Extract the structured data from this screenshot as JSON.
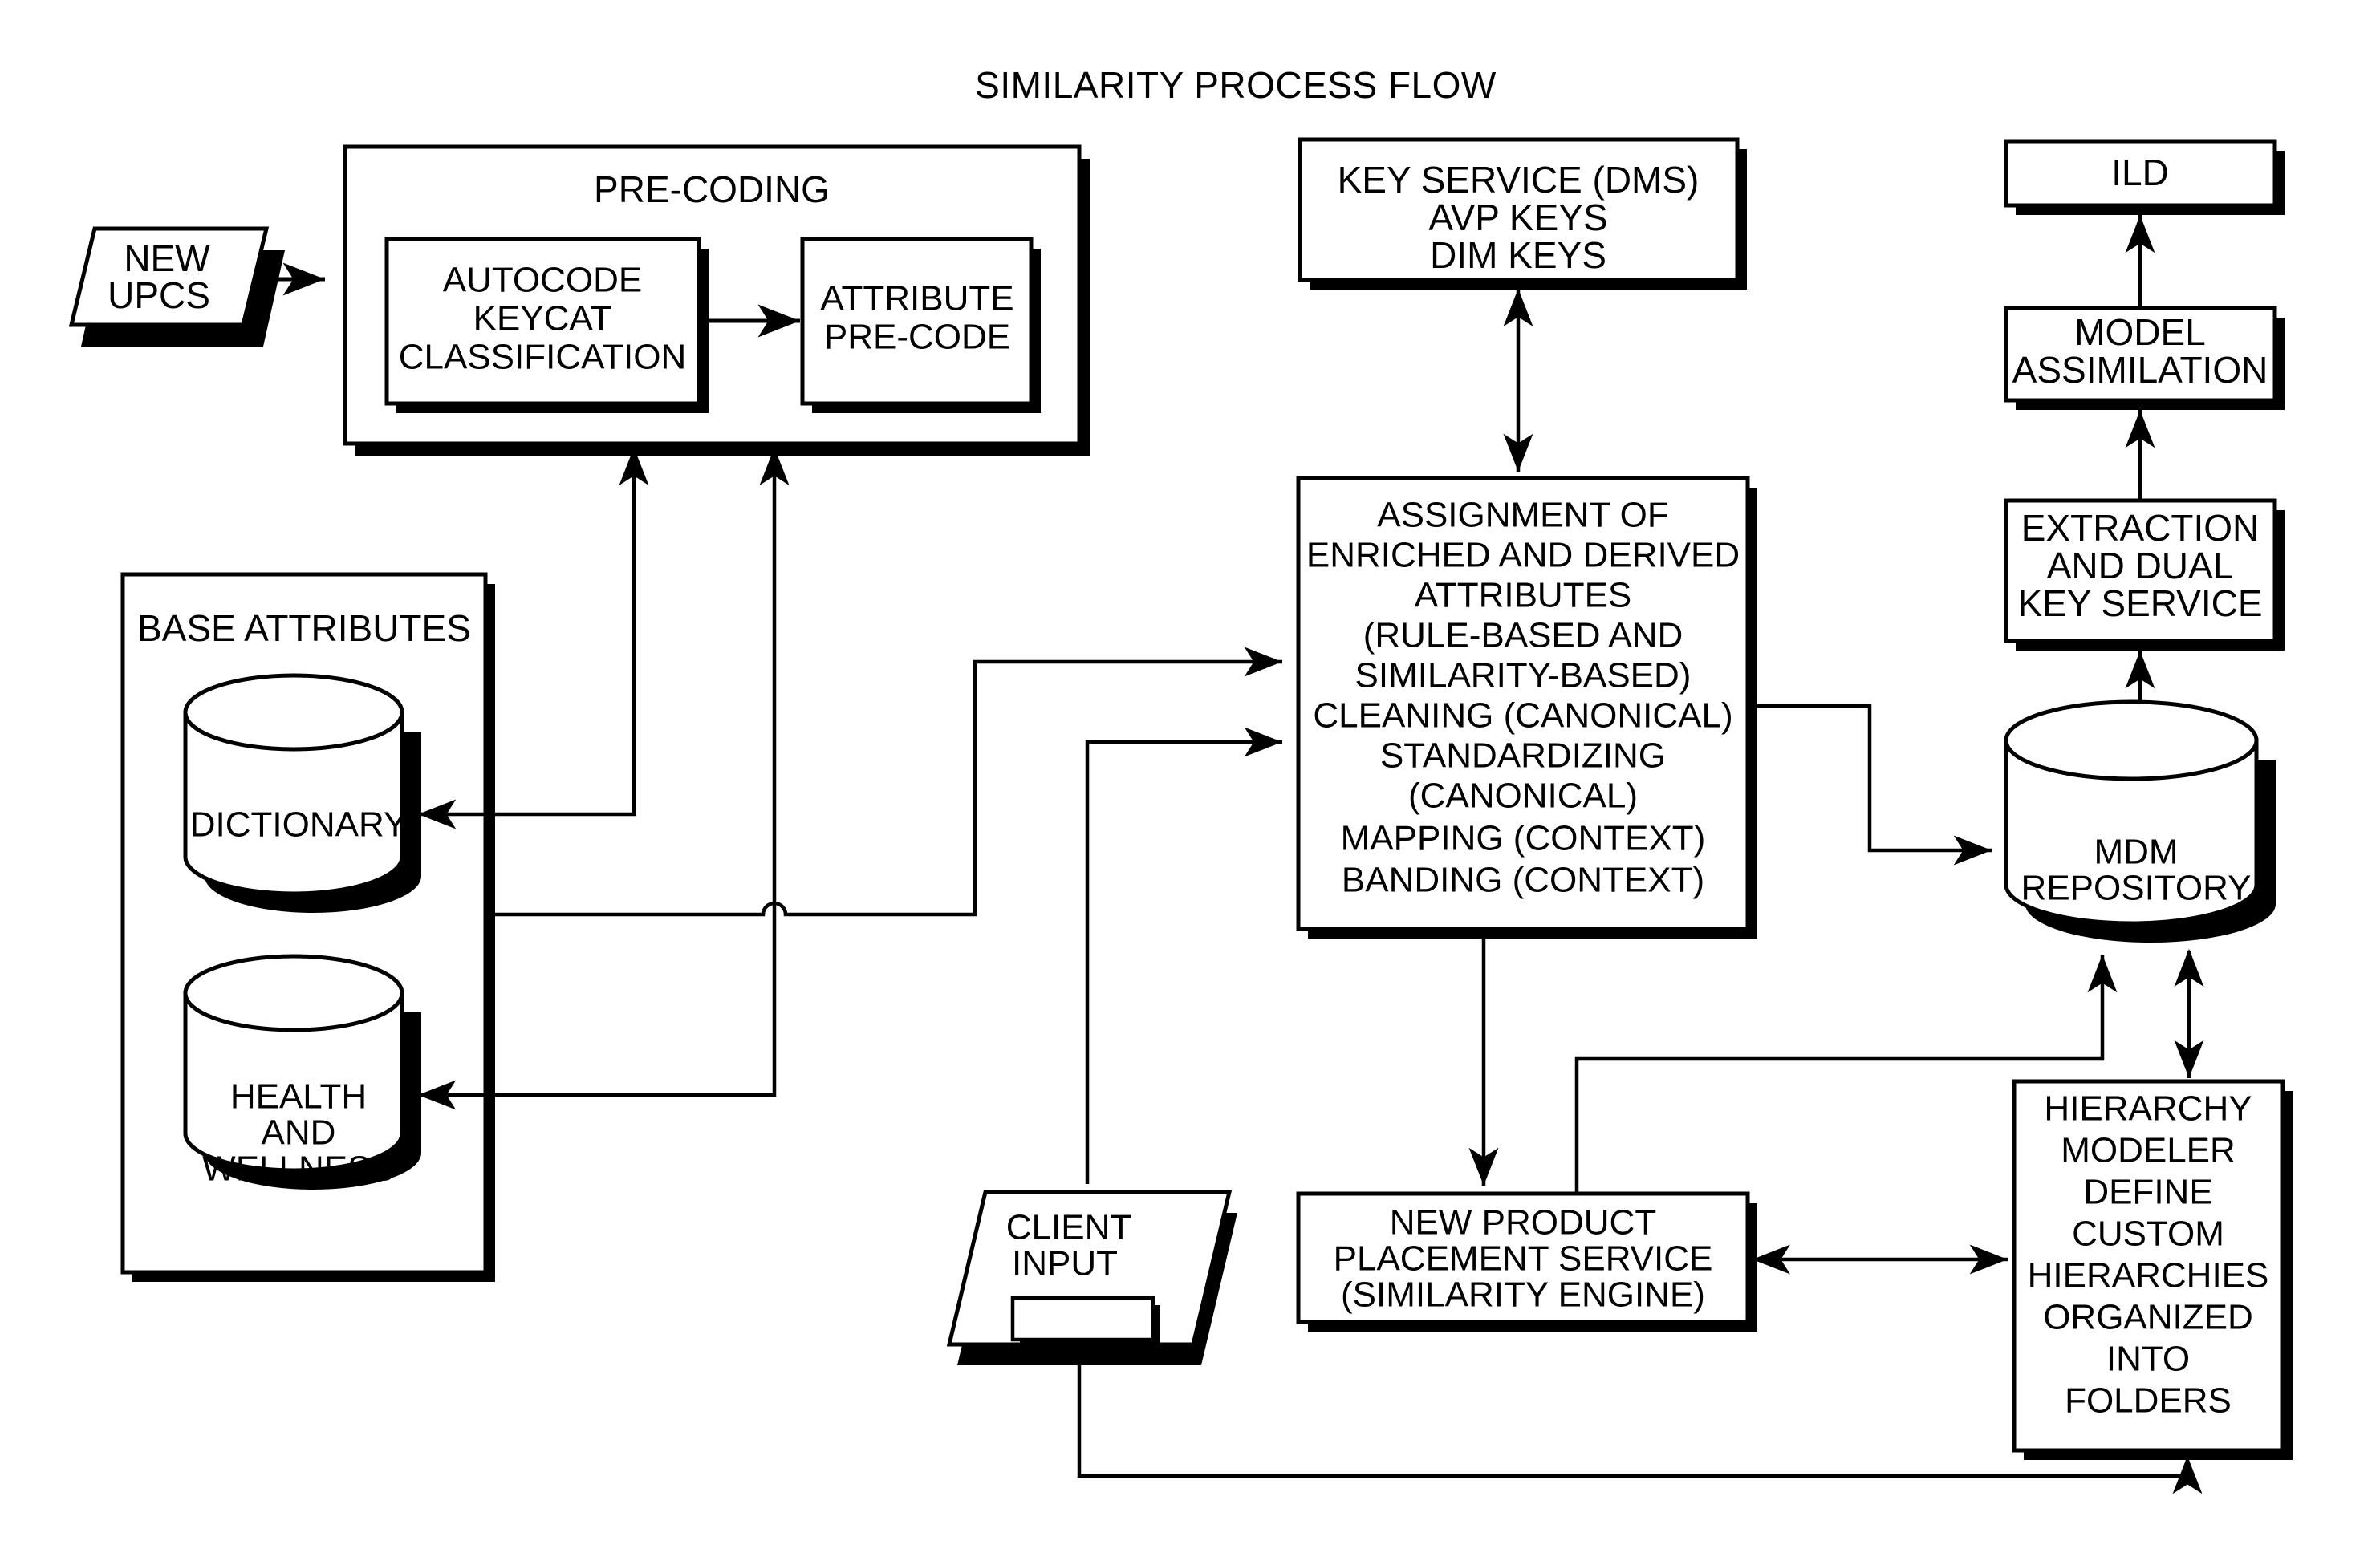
{
  "diagram": {
    "title": "SIMILARITY PROCESS FLOW",
    "nodes": {
      "new_upcs": "NEW\nUPCS",
      "new_upcs_l1": "NEW",
      "new_upcs_l2": "UPCS",
      "precoding_label": "PRE-CODING",
      "autocode_l1": "AUTOCODE",
      "autocode_l2": "KEYCAT",
      "autocode_l3": "CLASSIFICATION",
      "attribute_precode_l1": "ATTRIBUTE",
      "attribute_precode_l2": "PRE-CODE",
      "base_attributes_label": "BASE ATTRIBUTES",
      "dictionary": "DICTIONARY",
      "health_l1": "HEALTH",
      "health_l2": "AND",
      "health_l3": "WELLNESS",
      "key_service_l1": "KEY SERVICE (DMS)",
      "key_service_l2": "AVP KEYS",
      "key_service_l3": "DIM KEYS",
      "assignment_l1": "ASSIGNMENT OF",
      "assignment_l2": "ENRICHED AND DERIVED",
      "assignment_l3": "ATTRIBUTES",
      "assignment_l4": "(RULE-BASED AND",
      "assignment_l5": "SIMILARITY-BASED)",
      "assignment_l6": "CLEANING (CANONICAL)",
      "assignment_l7": "STANDARDIZING",
      "assignment_l8": "(CANONICAL)",
      "assignment_l9": "MAPPING (CONTEXT)",
      "assignment_l10": "BANDING (CONTEXT)",
      "client_input_l1": "CLIENT",
      "client_input_l2": "INPUT",
      "npps_l1": "NEW PRODUCT",
      "npps_l2": "PLACEMENT SERVICE",
      "npps_l3": "(SIMILARITY ENGINE)",
      "ild": "ILD",
      "model_assim_l1": "MODEL",
      "model_assim_l2": "ASSIMILATION",
      "extraction_l1": "EXTRACTION",
      "extraction_l2": "AND DUAL",
      "extraction_l3": "KEY SERVICE",
      "mdm_l1": "MDM",
      "mdm_l2": "REPOSITORY",
      "hierarchy_l1": "HIERARCHY",
      "hierarchy_l2": "MODELER",
      "hierarchy_l3": "DEFINE",
      "hierarchy_l4": "CUSTOM",
      "hierarchy_l5": "HIERARCHIES",
      "hierarchy_l6": "ORGANIZED",
      "hierarchy_l7": "INTO",
      "hierarchy_l8": "FOLDERS"
    },
    "colors": {
      "stroke": "#000000",
      "fill": "#ffffff",
      "background": "#ffffff"
    }
  }
}
